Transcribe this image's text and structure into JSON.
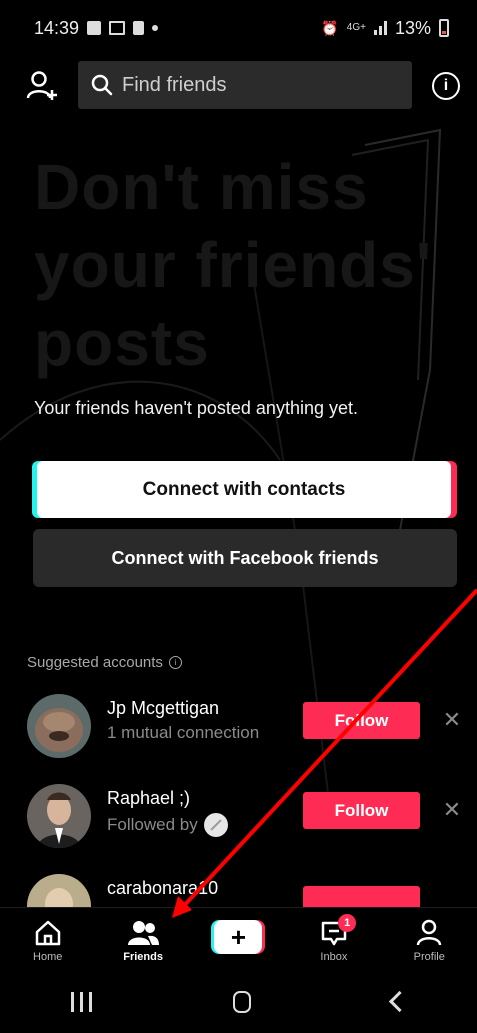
{
  "status_bar": {
    "time": "14:39",
    "battery": "13%"
  },
  "top_bar": {
    "search_placeholder": "Find friends"
  },
  "hero": {
    "watermark_lines": [
      "Don't miss",
      "your friends'",
      "posts"
    ],
    "empty_message": "Your friends haven't posted anything yet."
  },
  "actions": {
    "connect_contacts": "Connect with contacts",
    "connect_facebook": "Connect with Facebook friends"
  },
  "suggested": {
    "title": "Suggested accounts",
    "items": [
      {
        "name": "Jp Mcgettigan",
        "subtitle": "1 mutual connection",
        "follow_label": "Follow"
      },
      {
        "name": "Raphael ;)",
        "subtitle": "Followed by",
        "follow_label": "Follow"
      },
      {
        "name": "carabonara10"
      }
    ]
  },
  "bottom_nav": {
    "home": "Home",
    "friends": "Friends",
    "inbox": "Inbox",
    "inbox_badge": "1",
    "profile": "Profile"
  },
  "colors": {
    "accent": "#fe2c55",
    "cyan": "#25f4ee",
    "annotation_arrow": "#ff0000"
  }
}
